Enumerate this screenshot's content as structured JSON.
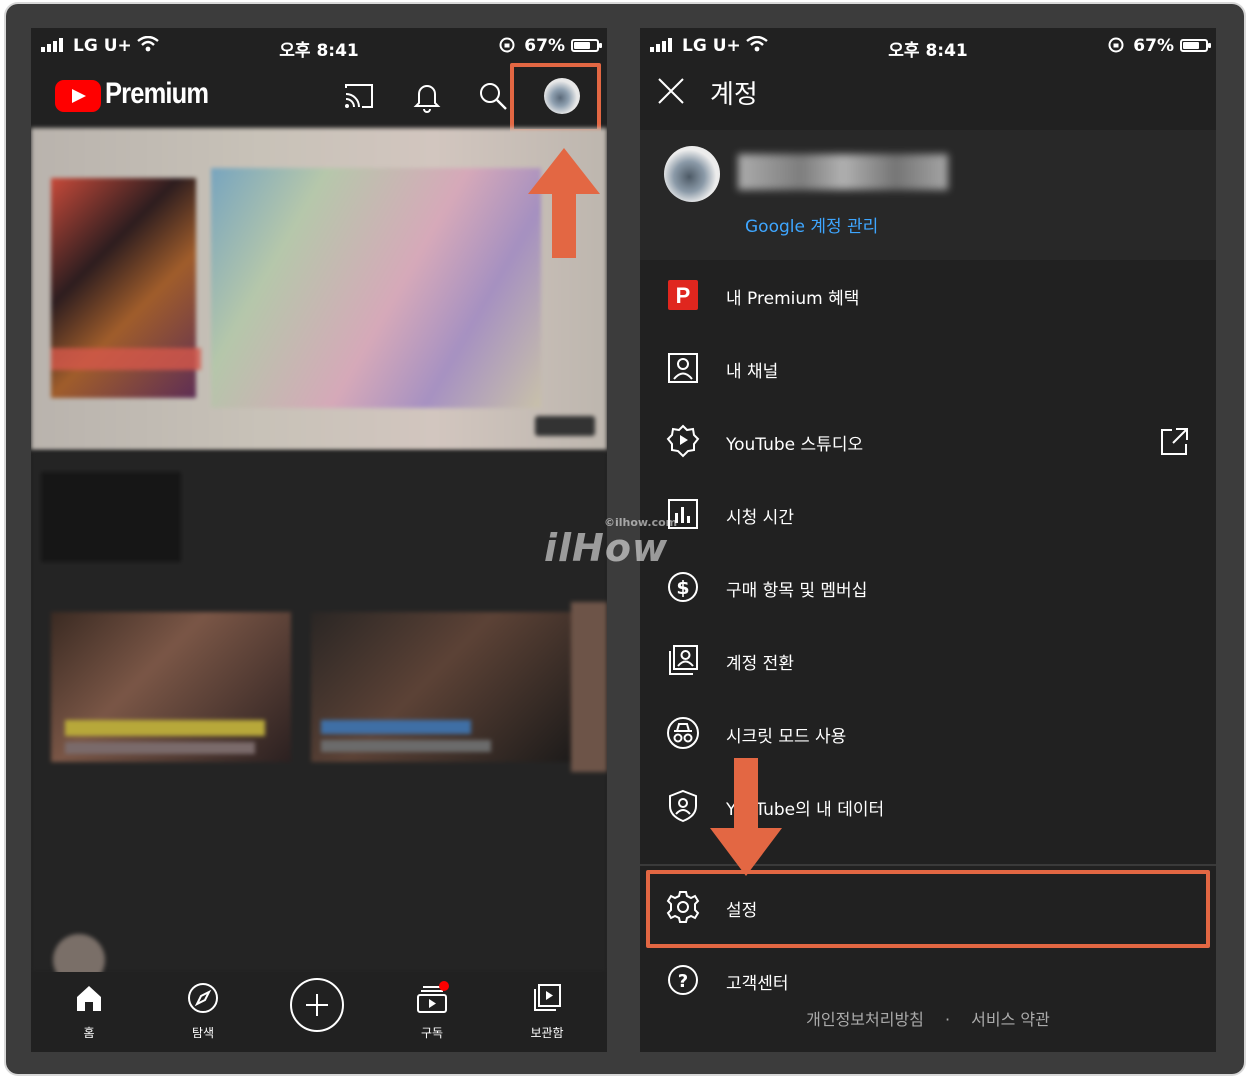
{
  "status_bar": {
    "carrier": "LG U+",
    "time": "오후 8:41",
    "battery": "67%"
  },
  "left": {
    "logo_text": "Premium",
    "nav": [
      {
        "label": "홈",
        "icon": "home-icon"
      },
      {
        "label": "탐색",
        "icon": "compass-icon"
      },
      {
        "label": "",
        "icon": "create-icon"
      },
      {
        "label": "구독",
        "icon": "subscriptions-icon"
      },
      {
        "label": "보관함",
        "icon": "library-icon"
      }
    ]
  },
  "right": {
    "title": "계정",
    "manage_account": "Google 계정 관리",
    "menu": [
      {
        "label": "내 Premium 혜택",
        "icon": "premium-icon"
      },
      {
        "label": "내 채널",
        "icon": "channel-icon"
      },
      {
        "label": "YouTube 스튜디오",
        "icon": "studio-icon"
      },
      {
        "label": "시청 시간",
        "icon": "watch-time-icon"
      },
      {
        "label": "구매 항목 및 멤버십",
        "icon": "dollar-icon"
      },
      {
        "label": "계정 전환",
        "icon": "switch-account-icon"
      },
      {
        "label": "시크릿 모드 사용",
        "icon": "incognito-icon"
      },
      {
        "label": "YouTube의 내 데이터",
        "icon": "shield-person-icon"
      },
      {
        "label": "설정",
        "icon": "gear-icon"
      },
      {
        "label": "고객센터",
        "icon": "help-icon"
      }
    ],
    "footer": {
      "privacy": "개인정보처리방침",
      "separator": "·",
      "terms": "서비스 약관"
    }
  },
  "watermark": {
    "small": "©ilhow.com",
    "big": "ilHow"
  },
  "colors": {
    "highlight": "#e36743",
    "link": "#3ea6ff",
    "yt_red": "#ff0000",
    "background": "#212121"
  }
}
